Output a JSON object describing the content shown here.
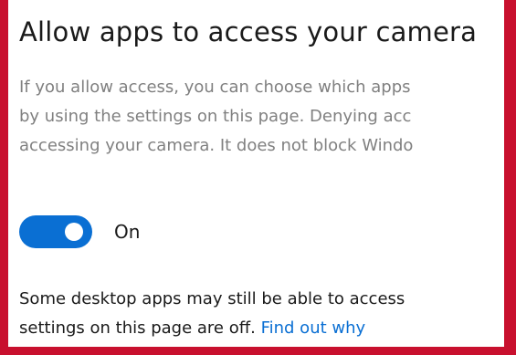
{
  "page": {
    "title": "Allow apps to access your camera",
    "description": [
      "If you allow access, you can choose which apps",
      "by using the settings on this page. Denying acc",
      "accessing your camera. It does not block Windo"
    ],
    "toggle": {
      "state": "On",
      "checked": true
    },
    "note": [
      "Some desktop apps may still be able to access",
      "settings on this page are off. "
    ],
    "link_label": "Find out why"
  },
  "colors": {
    "accent": "#0a6fd3",
    "frame_border": "#c8102e",
    "muted_text": "#808080"
  }
}
